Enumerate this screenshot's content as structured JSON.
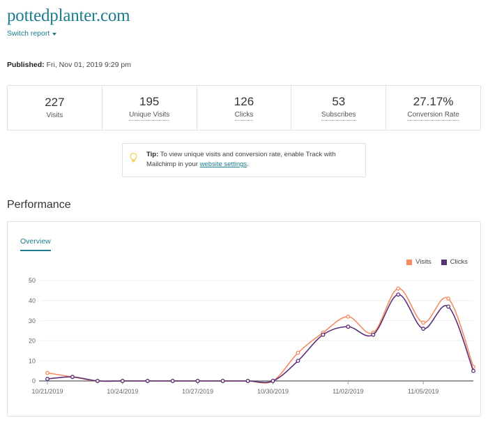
{
  "header": {
    "site_title": "pottedplanter.com",
    "switch_report": "Switch report",
    "switch_caret_icon": "chevron-down-icon",
    "published_label": "Published:",
    "published_value": "Fri, Nov 01, 2019 9:29 pm"
  },
  "stats": [
    {
      "value": "227",
      "label": "Visits",
      "dotted": false
    },
    {
      "value": "195",
      "label": "Unique Visits",
      "dotted": true
    },
    {
      "value": "126",
      "label": "Clicks",
      "dotted": true
    },
    {
      "value": "53",
      "label": "Subscribes",
      "dotted": true
    },
    {
      "value": "27.17%",
      "label": "Conversion Rate",
      "dotted": true
    }
  ],
  "tip": {
    "icon": "lightbulb-icon",
    "icon_color": "#f5c93a",
    "label": "Tip:",
    "text_before": " To view unique visits and conversion rate, enable Track with Mailchimp in your ",
    "link": "website settings",
    "text_after": "."
  },
  "performance": {
    "section_title": "Performance",
    "tabs": [
      {
        "label": "Overview",
        "active": true
      }
    ]
  },
  "colors": {
    "teal": "#1a7b8c",
    "visits": "#f58b63",
    "clicks": "#5c2d78",
    "grid": "#eeeeee",
    "axis": "#777777"
  },
  "chart_data": {
    "type": "line",
    "title": "Performance",
    "xlabel": "",
    "ylabel": "",
    "ylim": [
      0,
      50
    ],
    "yticks": [
      0,
      10,
      20,
      30,
      40,
      50
    ],
    "grid": true,
    "legend_position": "top-right",
    "x": [
      "10/21/2019",
      "10/22/2019",
      "10/23/2019",
      "10/24/2019",
      "10/25/2019",
      "10/26/2019",
      "10/27/2019",
      "10/28/2019",
      "10/29/2019",
      "10/30/2019",
      "10/31/2019",
      "11/01/2019",
      "11/02/2019",
      "11/03/2019",
      "11/04/2019",
      "11/05/2019",
      "11/06/2019",
      "11/07/2019"
    ],
    "xtick_labels": [
      "10/21/2019",
      "10/24/2019",
      "10/27/2019",
      "10/30/2019",
      "11/02/2019",
      "11/05/2019"
    ],
    "xtick_indices": [
      0,
      3,
      6,
      9,
      12,
      15
    ],
    "series": [
      {
        "name": "Visits",
        "color": "#f58b63",
        "values": [
          4,
          2,
          0,
          0,
          0,
          0,
          0,
          0,
          0,
          0,
          14,
          24,
          32,
          24,
          46,
          29,
          41,
          7
        ]
      },
      {
        "name": "Clicks",
        "color": "#5c2d78",
        "values": [
          1,
          2,
          0,
          0,
          0,
          0,
          0,
          0,
          0,
          0,
          10,
          23,
          27,
          23,
          43,
          26,
          37,
          5
        ]
      }
    ]
  }
}
